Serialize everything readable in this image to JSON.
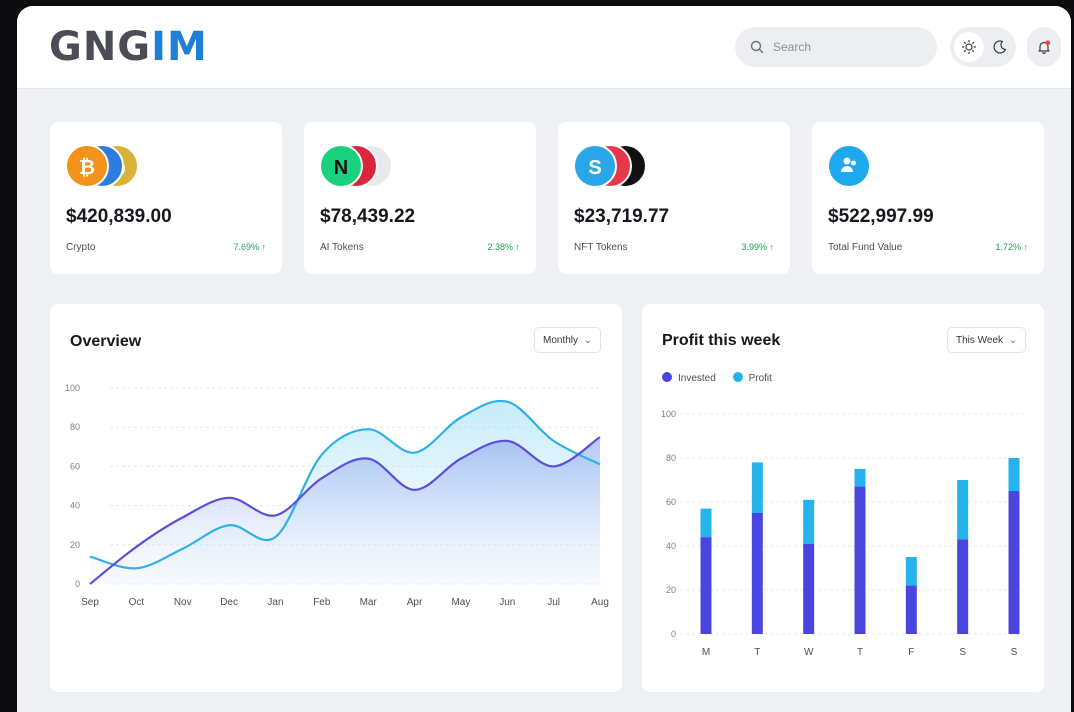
{
  "header": {
    "logo_main": "GNG",
    "logo_accent": "IM",
    "search_placeholder": "Search"
  },
  "stats": [
    {
      "amount": "$420,839.00",
      "label": "Crypto",
      "change": "7.69% ↑"
    },
    {
      "amount": "$78,439.22",
      "label": "AI Tokens",
      "change": "2.38% ↑"
    },
    {
      "amount": "$23,719.77",
      "label": "NFT Tokens",
      "change": "3.99% ↑"
    },
    {
      "amount": "$522,997.99",
      "label": "Total Fund Value",
      "change": "1.72% ↑"
    }
  ],
  "overview": {
    "title": "Overview",
    "period": "Monthly"
  },
  "profit": {
    "title": "Profit this week",
    "period": "This Week",
    "legend": [
      "Invested",
      "Profit"
    ]
  },
  "colors": {
    "invested": "#4b45df",
    "profit": "#26b3ec",
    "line_dark": "#5b4fdc",
    "line_light": "#2fb0e6",
    "positive": "#1aa35a",
    "brand": "#1e7fd8"
  },
  "chart_data": [
    {
      "type": "area",
      "title": "Overview",
      "categories": [
        "Sep",
        "Oct",
        "Nov",
        "Dec",
        "Jan",
        "Feb",
        "Mar",
        "Apr",
        "May",
        "Jun",
        "Jul",
        "Aug"
      ],
      "yticks": [
        0,
        20,
        40,
        60,
        80,
        100
      ],
      "ylim": [
        0,
        100
      ],
      "series": [
        {
          "values": [
            0,
            19,
            34,
            44,
            35,
            54,
            64,
            48,
            64,
            73,
            60,
            75
          ]
        },
        {
          "values": [
            14,
            8,
            18,
            30,
            24,
            66,
            79,
            67,
            85,
            93,
            73,
            61
          ]
        }
      ],
      "grid": true
    },
    {
      "type": "bar",
      "title": "Profit this week",
      "categories": [
        "M",
        "T",
        "W",
        "T",
        "F",
        "S",
        "S"
      ],
      "yticks": [
        0,
        20,
        40,
        60,
        80,
        100
      ],
      "ylim": [
        0,
        100
      ],
      "series": [
        {
          "name": "Invested",
          "values": [
            44,
            55,
            41,
            67,
            22,
            43,
            65
          ]
        },
        {
          "name": "Profit",
          "values": [
            13,
            23,
            20,
            8,
            13,
            27,
            15
          ]
        }
      ],
      "stacked": true,
      "grid": true
    }
  ]
}
